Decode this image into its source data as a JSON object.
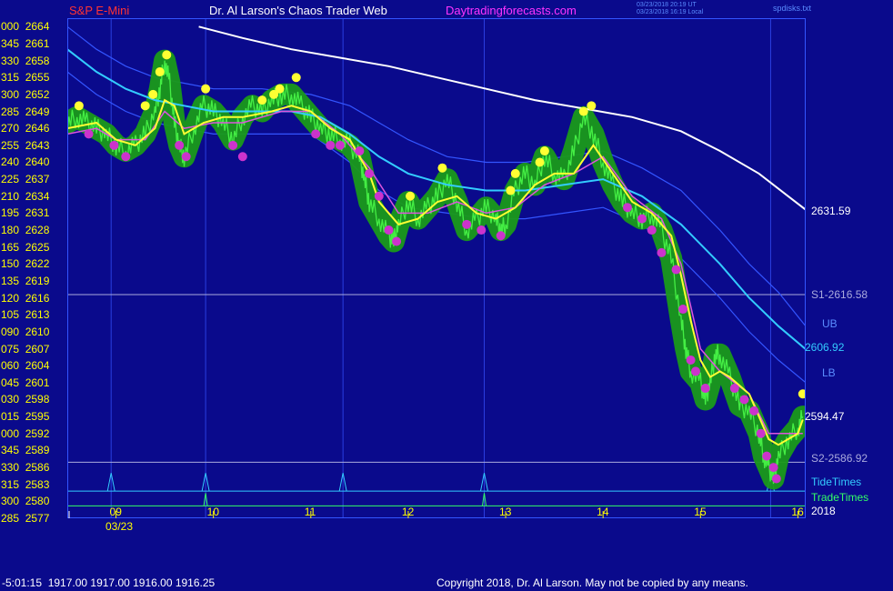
{
  "header": {
    "left_title": "S&P E-Mini",
    "center_title": "Dr. Al Larson's Chaos Trader Web",
    "site": "Daytradingforecasts.com",
    "timestamp_utc": "03/23/2018 20:19 UT",
    "timestamp_local": "03/23/2018 16:19 Local",
    "corner_note": "spdisks.txt"
  },
  "colors": {
    "background": "#0a0a8c",
    "axis_text": "#ffff00",
    "title_red": "#ff3333",
    "site_magenta": "#ff33ff",
    "price_green": "#22cc22",
    "bubble_green": "#1a9a1a",
    "yellow_line": "#ffff33",
    "white_line": "#ffffff",
    "cyan_line": "#33ccff",
    "band_blue": "#3355ff",
    "tide_cyan": "#33ccff",
    "trade_green": "#33ff66",
    "dot_yellow": "#ffff33",
    "dot_magenta": "#cc33cc"
  },
  "y_axis_labels": [
    {
      "left": "000",
      "price": "2664"
    },
    {
      "left": "345",
      "price": "2661"
    },
    {
      "left": "330",
      "price": "2658"
    },
    {
      "left": "315",
      "price": "2655"
    },
    {
      "left": "300",
      "price": "2652"
    },
    {
      "left": "285",
      "price": "2649"
    },
    {
      "left": "270",
      "price": "2646"
    },
    {
      "left": "255",
      "price": "2643"
    },
    {
      "left": "240",
      "price": "2640"
    },
    {
      "left": "225",
      "price": "2637"
    },
    {
      "left": "210",
      "price": "2634"
    },
    {
      "left": "195",
      "price": "2631"
    },
    {
      "left": "180",
      "price": "2628"
    },
    {
      "left": "165",
      "price": "2625"
    },
    {
      "left": "150",
      "price": "2622"
    },
    {
      "left": "135",
      "price": "2619"
    },
    {
      "left": "120",
      "price": "2616"
    },
    {
      "left": "105",
      "price": "2613"
    },
    {
      "left": "090",
      "price": "2610"
    },
    {
      "left": "075",
      "price": "2607"
    },
    {
      "left": "060",
      "price": "2604"
    },
    {
      "left": "045",
      "price": "2601"
    },
    {
      "left": "030",
      "price": "2598"
    },
    {
      "left": "015",
      "price": "2595"
    },
    {
      "left": "000",
      "price": "2592"
    },
    {
      "left": "345",
      "price": "2589"
    },
    {
      "left": "330",
      "price": "2586"
    },
    {
      "left": "315",
      "price": "2583"
    },
    {
      "left": "300",
      "price": "2580"
    },
    {
      "left": "285",
      "price": "2577"
    }
  ],
  "x_axis": {
    "hours": [
      "09",
      "10",
      "11",
      "12",
      "13",
      "14",
      "15",
      "16"
    ],
    "date": "03/23"
  },
  "right_labels": {
    "white_last": "2631.59",
    "s1": "S1-2616.58",
    "ub": "UB",
    "cyan_last": "2606.92",
    "lb": "LB",
    "price_last": "2594.47",
    "s2": "S2-2586.92",
    "tide": "TideTimes",
    "trade": "TradeTimes",
    "year": "2018"
  },
  "footer": {
    "readout": "-5:01:15  1917.00 1917.00 1916.00 1916.25",
    "copyright": "Copyright 2018, Dr. Al Larson. May not be copied by any means."
  },
  "chart_data": {
    "type": "line",
    "ylim": [
      2577,
      2665.5
    ],
    "xlim": [
      8.5,
      16.08
    ],
    "levels": {
      "S1": 2616.58,
      "S2": 2586.92
    },
    "tide_times": [
      8.95,
      9.92,
      11.33,
      12.78,
      15.72
    ],
    "trade_times": [
      9.92,
      12.78
    ],
    "vertical_lines": [
      8.95,
      9.92,
      11.33,
      12.78,
      15.72
    ],
    "price": [
      [
        8.5,
        2647
      ],
      [
        8.6,
        2648
      ],
      [
        8.7,
        2647
      ],
      [
        8.8,
        2646
      ],
      [
        8.9,
        2645
      ],
      [
        9.0,
        2643
      ],
      [
        9.1,
        2642
      ],
      [
        9.2,
        2643
      ],
      [
        9.3,
        2645
      ],
      [
        9.4,
        2649
      ],
      [
        9.45,
        2653
      ],
      [
        9.5,
        2658
      ],
      [
        9.55,
        2654
      ],
      [
        9.6,
        2647
      ],
      [
        9.65,
        2643
      ],
      [
        9.7,
        2641
      ],
      [
        9.8,
        2646
      ],
      [
        9.9,
        2650
      ],
      [
        10.0,
        2649
      ],
      [
        10.1,
        2647
      ],
      [
        10.2,
        2644
      ],
      [
        10.3,
        2648
      ],
      [
        10.4,
        2650
      ],
      [
        10.5,
        2649
      ],
      [
        10.6,
        2651
      ],
      [
        10.7,
        2652
      ],
      [
        10.8,
        2652
      ],
      [
        10.9,
        2650
      ],
      [
        11.0,
        2648
      ],
      [
        11.1,
        2646
      ],
      [
        11.2,
        2645
      ],
      [
        11.3,
        2644
      ],
      [
        11.4,
        2643
      ],
      [
        11.5,
        2641
      ],
      [
        11.55,
        2637
      ],
      [
        11.6,
        2633
      ],
      [
        11.7,
        2630
      ],
      [
        11.8,
        2627
      ],
      [
        11.85,
        2626
      ],
      [
        11.9,
        2629
      ],
      [
        12.0,
        2633
      ],
      [
        12.1,
        2630
      ],
      [
        12.2,
        2632
      ],
      [
        12.3,
        2634
      ],
      [
        12.4,
        2637
      ],
      [
        12.5,
        2633
      ],
      [
        12.6,
        2628
      ],
      [
        12.7,
        2630
      ],
      [
        12.8,
        2632
      ],
      [
        12.9,
        2630
      ],
      [
        12.95,
        2628
      ],
      [
        13.0,
        2629
      ],
      [
        13.1,
        2635
      ],
      [
        13.2,
        2638
      ],
      [
        13.3,
        2636
      ],
      [
        13.4,
        2641
      ],
      [
        13.5,
        2638
      ],
      [
        13.6,
        2637
      ],
      [
        13.7,
        2642
      ],
      [
        13.8,
        2648
      ],
      [
        13.9,
        2645
      ],
      [
        14.0,
        2640
      ],
      [
        14.1,
        2636
      ],
      [
        14.2,
        2633
      ],
      [
        14.3,
        2631
      ],
      [
        14.4,
        2630
      ],
      [
        14.5,
        2631
      ],
      [
        14.6,
        2628
      ],
      [
        14.7,
        2623
      ],
      [
        14.8,
        2612
      ],
      [
        14.85,
        2607
      ],
      [
        14.9,
        2603
      ],
      [
        15.0,
        2601
      ],
      [
        15.05,
        2598
      ],
      [
        15.1,
        2601
      ],
      [
        15.15,
        2606
      ],
      [
        15.2,
        2606
      ],
      [
        15.3,
        2602
      ],
      [
        15.4,
        2597
      ],
      [
        15.5,
        2596
      ],
      [
        15.6,
        2592
      ],
      [
        15.65,
        2588
      ],
      [
        15.7,
        2586
      ],
      [
        15.75,
        2584
      ],
      [
        15.8,
        2588
      ],
      [
        15.9,
        2591
      ],
      [
        16.0,
        2593
      ],
      [
        16.05,
        2595
      ]
    ],
    "yellow_avg": [
      [
        8.5,
        2646
      ],
      [
        8.8,
        2647
      ],
      [
        9.0,
        2644
      ],
      [
        9.2,
        2643
      ],
      [
        9.4,
        2646
      ],
      [
        9.5,
        2651
      ],
      [
        9.6,
        2650
      ],
      [
        9.7,
        2645
      ],
      [
        9.9,
        2647
      ],
      [
        10.1,
        2648
      ],
      [
        10.3,
        2648
      ],
      [
        10.6,
        2649
      ],
      [
        10.8,
        2650
      ],
      [
        11.0,
        2649
      ],
      [
        11.2,
        2646
      ],
      [
        11.4,
        2644
      ],
      [
        11.6,
        2638
      ],
      [
        11.7,
        2633
      ],
      [
        11.9,
        2629
      ],
      [
        12.1,
        2630
      ],
      [
        12.3,
        2633
      ],
      [
        12.5,
        2634
      ],
      [
        12.7,
        2631
      ],
      [
        12.9,
        2630
      ],
      [
        13.1,
        2632
      ],
      [
        13.3,
        2636
      ],
      [
        13.5,
        2638
      ],
      [
        13.7,
        2638
      ],
      [
        13.9,
        2643
      ],
      [
        14.1,
        2638
      ],
      [
        14.3,
        2633
      ],
      [
        14.5,
        2631
      ],
      [
        14.7,
        2627
      ],
      [
        14.8,
        2620
      ],
      [
        14.9,
        2612
      ],
      [
        15.0,
        2605
      ],
      [
        15.1,
        2602
      ],
      [
        15.2,
        2603
      ],
      [
        15.3,
        2602
      ],
      [
        15.5,
        2599
      ],
      [
        15.6,
        2595
      ],
      [
        15.7,
        2591
      ],
      [
        15.8,
        2590
      ],
      [
        16.0,
        2592
      ],
      [
        16.05,
        2594.47
      ]
    ],
    "magenta_avg": [
      [
        8.5,
        2645
      ],
      [
        8.8,
        2646
      ],
      [
        9.0,
        2644
      ],
      [
        9.3,
        2644
      ],
      [
        9.5,
        2649
      ],
      [
        9.7,
        2646
      ],
      [
        10.0,
        2647
      ],
      [
        10.3,
        2647
      ],
      [
        10.7,
        2649
      ],
      [
        11.0,
        2649
      ],
      [
        11.3,
        2645
      ],
      [
        11.6,
        2639
      ],
      [
        11.9,
        2631
      ],
      [
        12.2,
        2631
      ],
      [
        12.5,
        2633
      ],
      [
        12.8,
        2631
      ],
      [
        13.1,
        2632
      ],
      [
        13.4,
        2636
      ],
      [
        13.7,
        2638
      ],
      [
        14.0,
        2641
      ],
      [
        14.3,
        2634
      ],
      [
        14.6,
        2630
      ],
      [
        14.8,
        2622
      ],
      [
        15.0,
        2607
      ],
      [
        15.2,
        2603
      ],
      [
        15.5,
        2599
      ],
      [
        15.7,
        2592
      ],
      [
        16.05,
        2592
      ]
    ],
    "white_avg": [
      [
        9.85,
        2664
      ],
      [
        10.3,
        2662
      ],
      [
        10.8,
        2660
      ],
      [
        11.3,
        2658.5
      ],
      [
        11.8,
        2657
      ],
      [
        12.3,
        2655
      ],
      [
        12.8,
        2653
      ],
      [
        13.3,
        2651
      ],
      [
        13.8,
        2649.5
      ],
      [
        14.3,
        2648
      ],
      [
        14.8,
        2645.5
      ],
      [
        15.2,
        2642
      ],
      [
        15.6,
        2638
      ],
      [
        15.9,
        2634
      ],
      [
        16.08,
        2631.59
      ]
    ],
    "cyan_avg": [
      [
        8.5,
        2660
      ],
      [
        8.8,
        2656
      ],
      [
        9.1,
        2653
      ],
      [
        9.4,
        2651
      ],
      [
        9.7,
        2650
      ],
      [
        10.0,
        2649
      ],
      [
        10.4,
        2649
      ],
      [
        10.8,
        2649
      ],
      [
        11.1,
        2648
      ],
      [
        11.4,
        2645
      ],
      [
        11.7,
        2641
      ],
      [
        12.0,
        2638
      ],
      [
        12.4,
        2636
      ],
      [
        12.8,
        2635
      ],
      [
        13.2,
        2635
      ],
      [
        13.6,
        2636
      ],
      [
        14.0,
        2637
      ],
      [
        14.4,
        2634
      ],
      [
        14.8,
        2629
      ],
      [
        15.2,
        2622
      ],
      [
        15.5,
        2616
      ],
      [
        15.8,
        2611
      ],
      [
        16.08,
        2606.92
      ]
    ],
    "upper_band": [
      [
        8.5,
        2664
      ],
      [
        8.8,
        2660
      ],
      [
        9.1,
        2657
      ],
      [
        9.4,
        2655
      ],
      [
        9.7,
        2654
      ],
      [
        10.0,
        2653
      ],
      [
        10.5,
        2653
      ],
      [
        11.0,
        2652
      ],
      [
        11.4,
        2650
      ],
      [
        11.7,
        2647
      ],
      [
        12.0,
        2644
      ],
      [
        12.4,
        2641
      ],
      [
        12.8,
        2640
      ],
      [
        13.2,
        2640
      ],
      [
        13.6,
        2641
      ],
      [
        14.0,
        2642
      ],
      [
        14.4,
        2639
      ],
      [
        14.8,
        2635
      ],
      [
        15.2,
        2628
      ],
      [
        15.5,
        2622
      ],
      [
        15.8,
        2617
      ],
      [
        16.08,
        2611
      ]
    ],
    "lower_band": [
      [
        8.5,
        2656
      ],
      [
        8.8,
        2652
      ],
      [
        9.1,
        2649
      ],
      [
        9.4,
        2647
      ],
      [
        9.7,
        2646
      ],
      [
        10.0,
        2645
      ],
      [
        10.5,
        2645
      ],
      [
        11.0,
        2645
      ],
      [
        11.4,
        2640
      ],
      [
        11.7,
        2635
      ],
      [
        12.0,
        2632
      ],
      [
        12.4,
        2631
      ],
      [
        12.8,
        2630
      ],
      [
        13.2,
        2630
      ],
      [
        13.6,
        2631
      ],
      [
        14.0,
        2632
      ],
      [
        14.4,
        2629
      ],
      [
        14.8,
        2623
      ],
      [
        15.2,
        2616
      ],
      [
        15.5,
        2610
      ],
      [
        15.8,
        2605
      ],
      [
        16.08,
        2601
      ]
    ],
    "yellow_dots": [
      [
        8.62,
        2650
      ],
      [
        9.3,
        2650
      ],
      [
        9.38,
        2652
      ],
      [
        9.45,
        2656
      ],
      [
        9.52,
        2659
      ],
      [
        9.92,
        2653
      ],
      [
        10.5,
        2651
      ],
      [
        10.62,
        2652
      ],
      [
        10.68,
        2653
      ],
      [
        10.85,
        2655
      ],
      [
        12.02,
        2634
      ],
      [
        12.35,
        2639
      ],
      [
        13.05,
        2635
      ],
      [
        13.1,
        2638
      ],
      [
        13.35,
        2640
      ],
      [
        13.4,
        2642
      ],
      [
        13.8,
        2649
      ],
      [
        13.88,
        2650
      ],
      [
        16.05,
        2599
      ]
    ],
    "magenta_dots": [
      [
        8.72,
        2645
      ],
      [
        8.98,
        2643
      ],
      [
        9.1,
        2641
      ],
      [
        9.65,
        2643
      ],
      [
        9.72,
        2641
      ],
      [
        10.2,
        2643
      ],
      [
        10.3,
        2641
      ],
      [
        11.05,
        2645
      ],
      [
        11.2,
        2643
      ],
      [
        11.3,
        2643
      ],
      [
        11.5,
        2642
      ],
      [
        11.6,
        2638
      ],
      [
        11.7,
        2634
      ],
      [
        11.8,
        2628
      ],
      [
        11.88,
        2626
      ],
      [
        12.6,
        2629
      ],
      [
        12.75,
        2628
      ],
      [
        12.95,
        2627
      ],
      [
        14.25,
        2632
      ],
      [
        14.4,
        2630
      ],
      [
        14.5,
        2628
      ],
      [
        14.6,
        2624
      ],
      [
        14.75,
        2621
      ],
      [
        14.82,
        2614
      ],
      [
        14.9,
        2605
      ],
      [
        14.95,
        2603
      ],
      [
        15.05,
        2600
      ],
      [
        15.35,
        2600
      ],
      [
        15.45,
        2598
      ],
      [
        15.55,
        2596
      ],
      [
        15.62,
        2592
      ],
      [
        15.68,
        2588
      ],
      [
        15.75,
        2586
      ],
      [
        15.78,
        2584
      ]
    ]
  }
}
